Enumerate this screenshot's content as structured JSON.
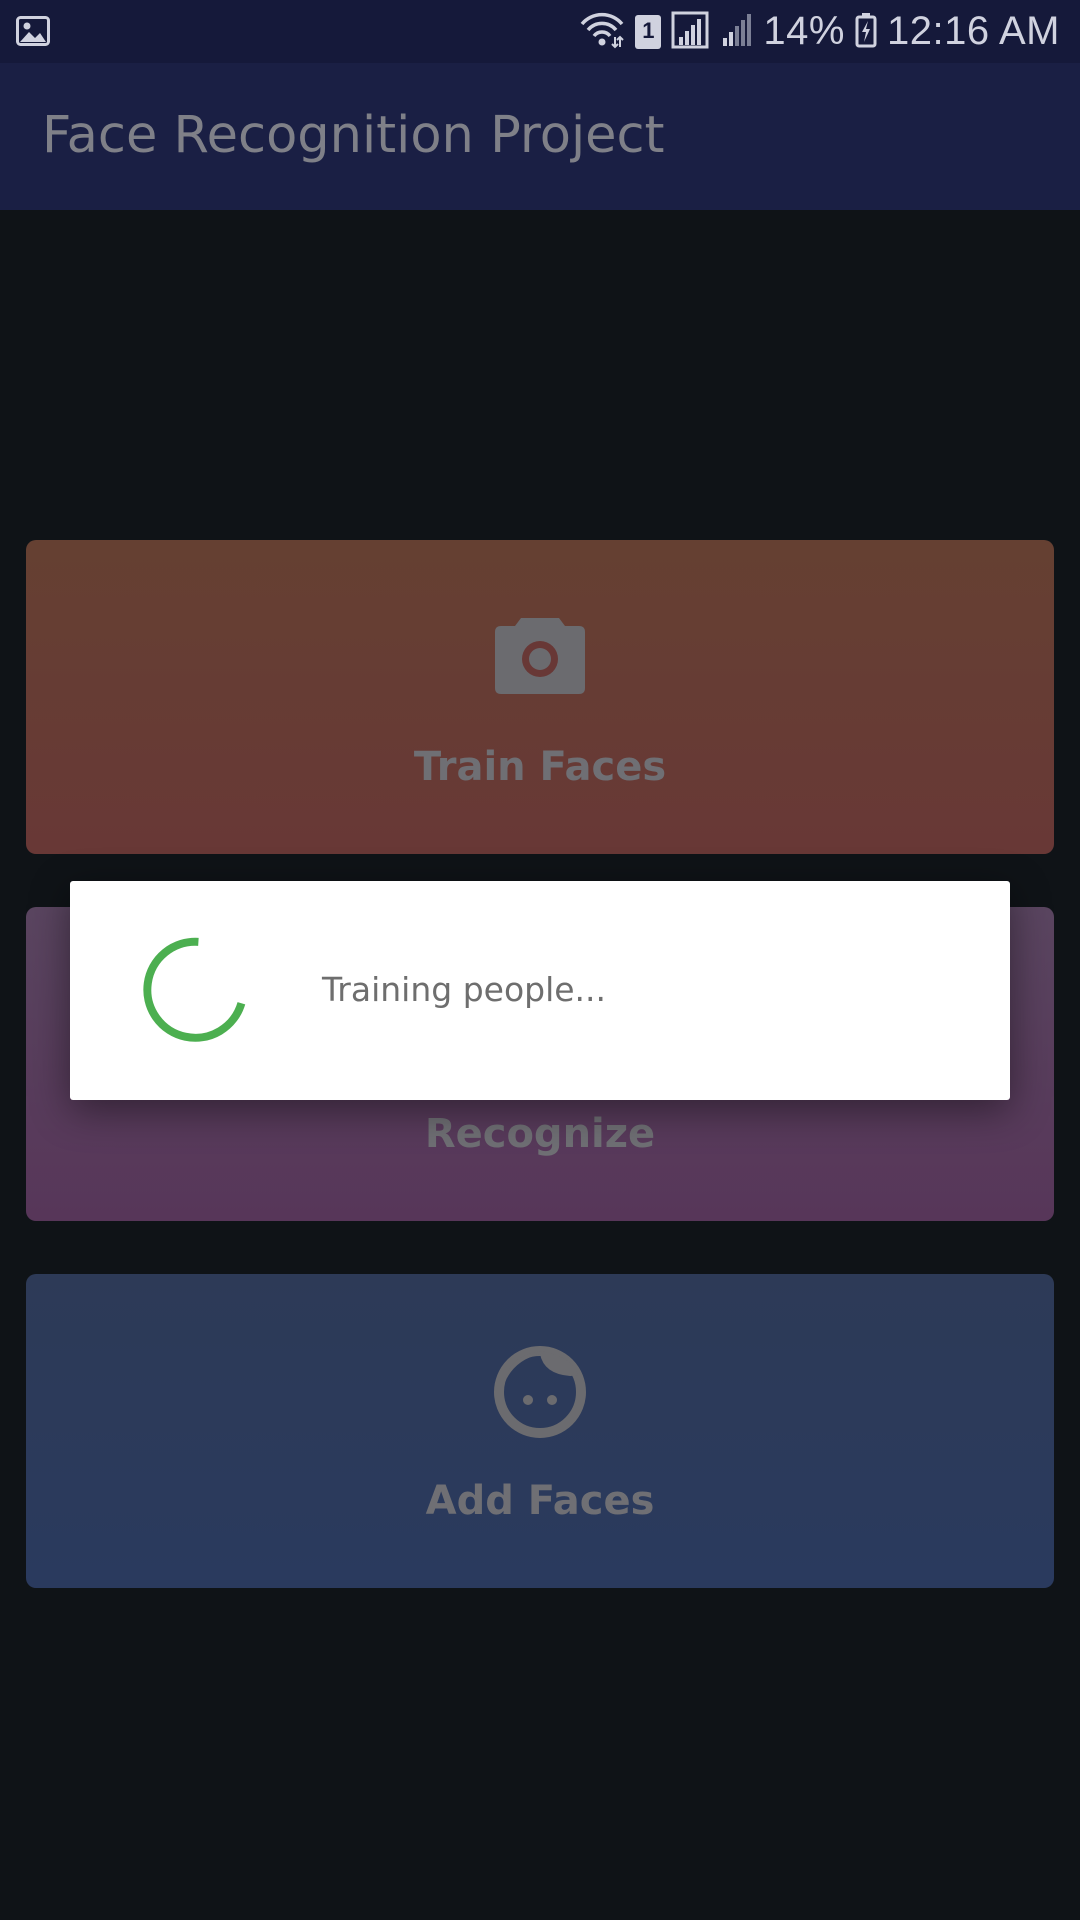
{
  "status_bar": {
    "battery": "14%",
    "time": "12:16 AM",
    "sim": "1",
    "icons": [
      "image-icon",
      "wifi-icon",
      "sim-icon",
      "signal-icon",
      "signal-icon",
      "battery-charging-icon"
    ]
  },
  "toolbar": {
    "title": "Face Recognition Project"
  },
  "cards": {
    "train": {
      "label": "Train Faces",
      "icon": "camera-icon",
      "color": "#683836"
    },
    "recognize": {
      "label": "Recognize",
      "color": "#573659"
    },
    "add": {
      "label": "Add Faces",
      "icon": "face-icon",
      "color": "#2a3a5e"
    }
  },
  "dialog": {
    "message": "Training people...",
    "spinner_color": "#4caf50"
  }
}
